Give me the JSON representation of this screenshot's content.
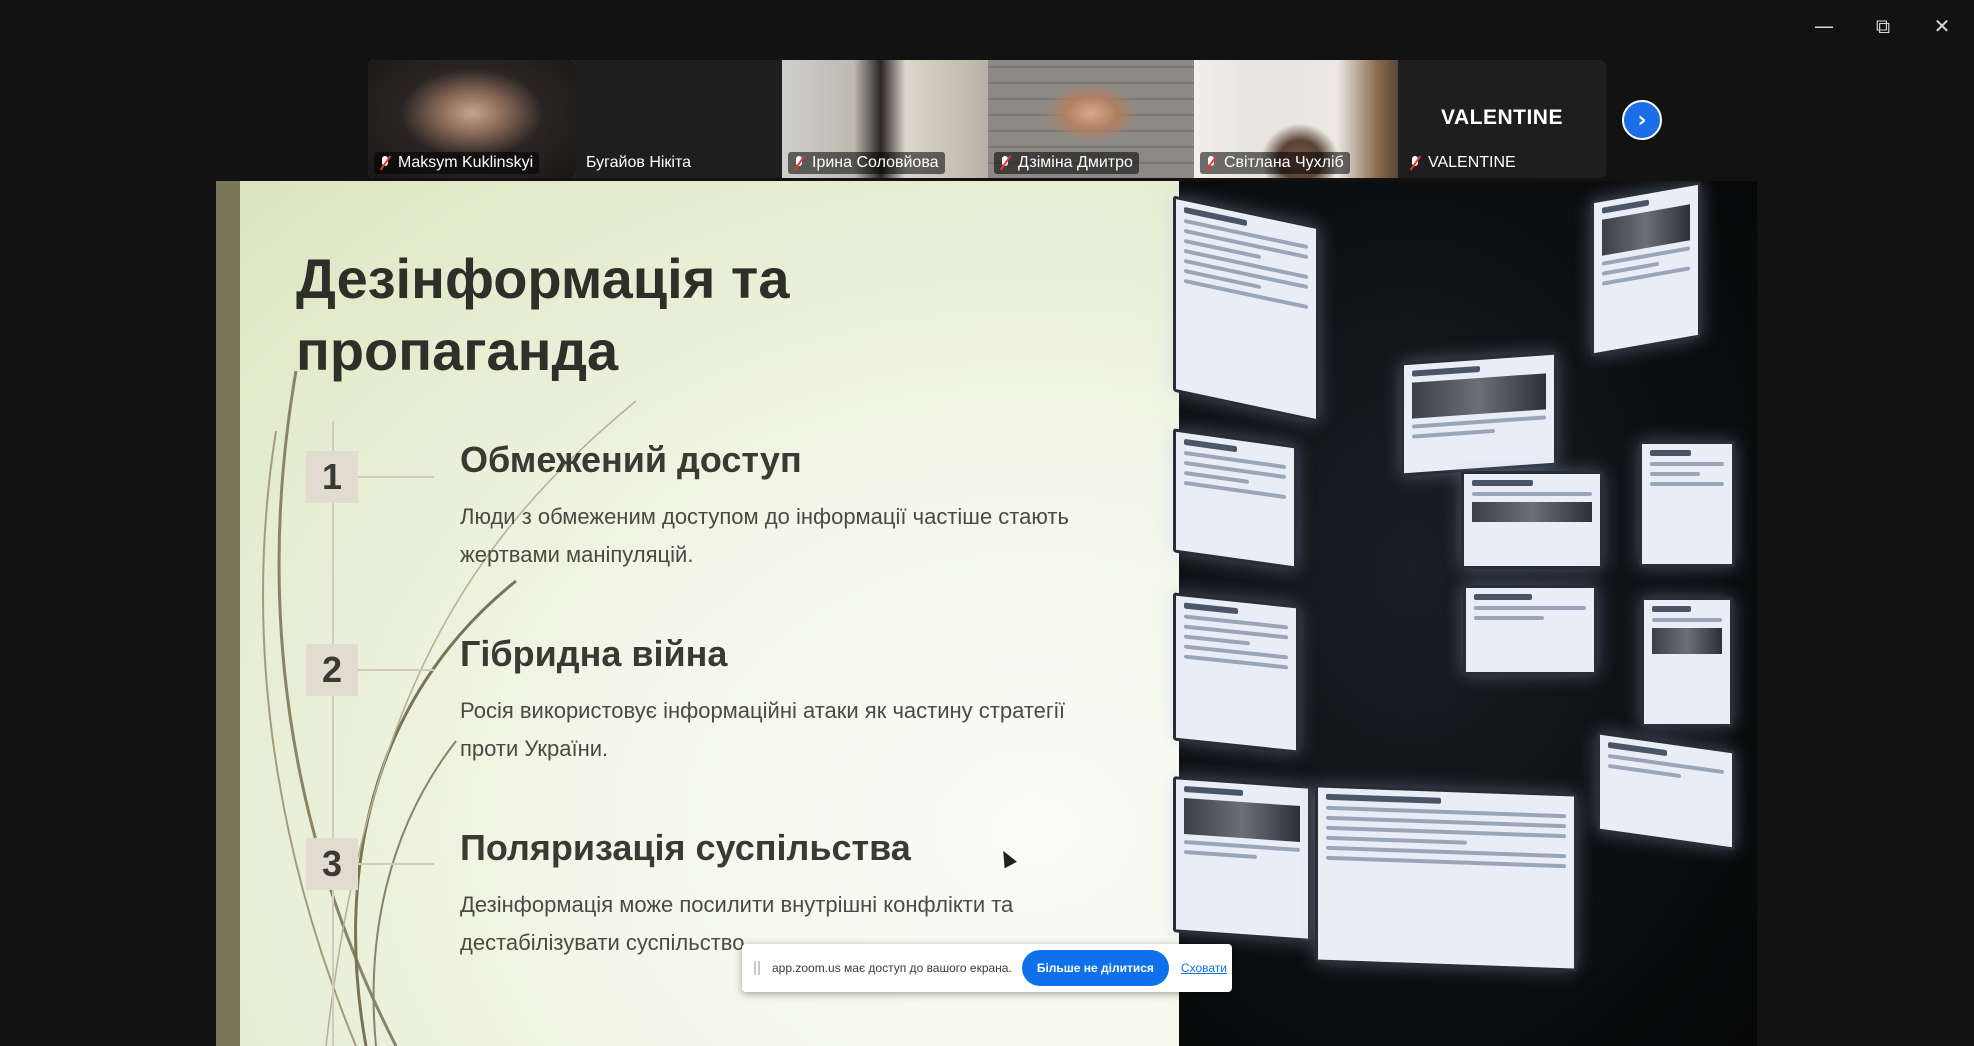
{
  "window_controls": {
    "minimize_icon": "minimize-icon",
    "restore_icon": "restore-icon",
    "close_icon": "close-icon"
  },
  "participants": [
    {
      "name": "Maksym Kuklinskyi",
      "muted": true,
      "active_speaker": true
    },
    {
      "name": "Бугайов Нікіта",
      "muted": false
    },
    {
      "name": "Ірина Соловйова",
      "muted": true
    },
    {
      "name": "Дзіміна Дмитро",
      "muted": true
    },
    {
      "name": "Світлана Чухліб",
      "muted": true
    },
    {
      "name": "VALENTINE",
      "muted": true,
      "display_text": "VALENTINE"
    }
  ],
  "slide": {
    "title": "Дезінформація та пропаганда",
    "items": [
      {
        "number": "1",
        "heading": "Обмежений доступ",
        "text": "Люди з обмеженим доступом до інформації частіше стають жертвами маніпуляцій."
      },
      {
        "number": "2",
        "heading": "Гібридна війна",
        "text": "Росія використовує інформаційні атаки як частину стратегії проти України."
      },
      {
        "number": "3",
        "heading": "Поляризація суспільства",
        "text": "Дезінформація може посилити внутрішні конфлікти та дестабілізувати суспільство."
      }
    ]
  },
  "share_bar": {
    "message": "app.zoom.us має доступ до вашого екрана.",
    "stop_label": "Більше не ділитися",
    "hide_label": "Сховати"
  },
  "colors": {
    "active_speaker": "#22c55e",
    "zoom_blue": "#0e71eb"
  }
}
